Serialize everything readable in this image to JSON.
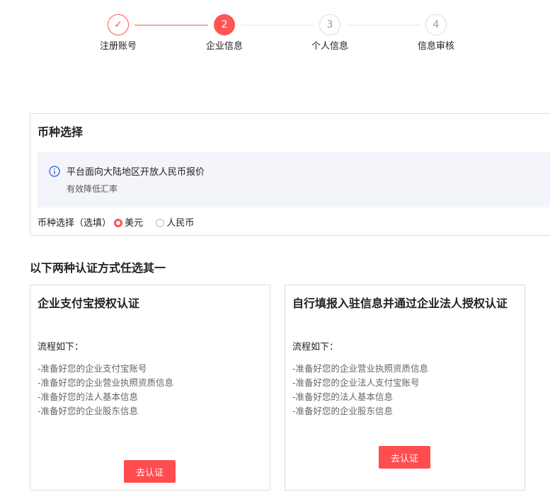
{
  "steps": [
    {
      "label": "注册账号",
      "number": "",
      "state": "done"
    },
    {
      "label": "企业信息",
      "number": "2",
      "state": "active"
    },
    {
      "label": "个人信息",
      "number": "3",
      "state": "todo"
    },
    {
      "label": "信息审核",
      "number": "4",
      "state": "todo"
    }
  ],
  "currency": {
    "title": "币种选择",
    "info_line1": "平台面向大陆地区开放人民币报价",
    "info_line2": "有效降低汇率",
    "field_label": "币种选择（选填）",
    "options": [
      {
        "label": "美元",
        "selected": true
      },
      {
        "label": "人民币",
        "selected": false
      }
    ]
  },
  "auth": {
    "heading": "以下两种认证方式任选其一",
    "cards": [
      {
        "title": "企业支付宝授权认证",
        "flow_label": "流程如下：",
        "items": [
          "-准备好您的企业支付宝账号",
          "-准备好您的企业营业执照资质信息",
          "-准备好您的法人基本信息",
          "-准备好您的企业股东信息"
        ],
        "button": "去认证"
      },
      {
        "title": "自行填报入驻信息并通过企业法人授权认证",
        "flow_label": "流程如下：",
        "items": [
          "-准备好您的企业营业执照资质信息",
          "-准备好您的企业法人支付宝账号",
          "-准备好您的法人基本信息",
          "-准备好您的企业股东信息"
        ],
        "button": "去认证"
      }
    ]
  },
  "colors": {
    "accent": "#ff5555",
    "button": "#ff4d4f"
  }
}
